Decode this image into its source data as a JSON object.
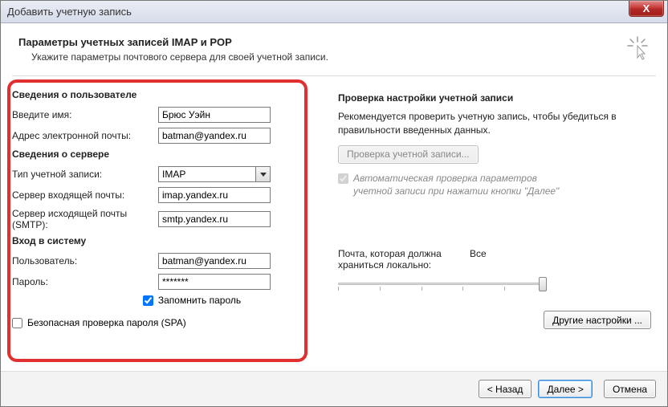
{
  "window": {
    "title": "Добавить учетную запись"
  },
  "header": {
    "title": "Параметры учетных записей IMAP и POP",
    "subtitle": "Укажите параметры почтового сервера для своей учетной записи."
  },
  "left": {
    "user_section": "Сведения о пользователе",
    "name_label": "Введите имя:",
    "name_value": "Брюс Уэйн",
    "email_label": "Адрес электронной почты:",
    "email_value": "batman@yandex.ru",
    "server_section": "Сведения о сервере",
    "type_label": "Тип учетной записи:",
    "type_value": "IMAP",
    "incoming_label": "Сервер входящей почты:",
    "incoming_value": "imap.yandex.ru",
    "outgoing_label": "Сервер исходящей почты (SMTP):",
    "outgoing_value": "smtp.yandex.ru",
    "login_section": "Вход в систему",
    "user_label": "Пользователь:",
    "user_value": "batman@yandex.ru",
    "password_label": "Пароль:",
    "password_value": "*******",
    "remember_label": "Запомнить пароль",
    "spa_label": "Безопасная проверка пароля (SPA)"
  },
  "right": {
    "title": "Проверка настройки учетной записи",
    "hint": "Рекомендуется проверить учетную запись, чтобы убедиться в правильности введенных данных.",
    "test_button": "Проверка учетной записи...",
    "auto_label": "Автоматическая проверка параметров учетной записи при нажатии кнопки \"Далее\"",
    "storage_label": "Почта, которая должна храниться локально:",
    "storage_value": "Все",
    "other_button": "Другие настройки ..."
  },
  "footer": {
    "back": "< Назад",
    "next": "Далее >",
    "cancel": "Отмена"
  }
}
